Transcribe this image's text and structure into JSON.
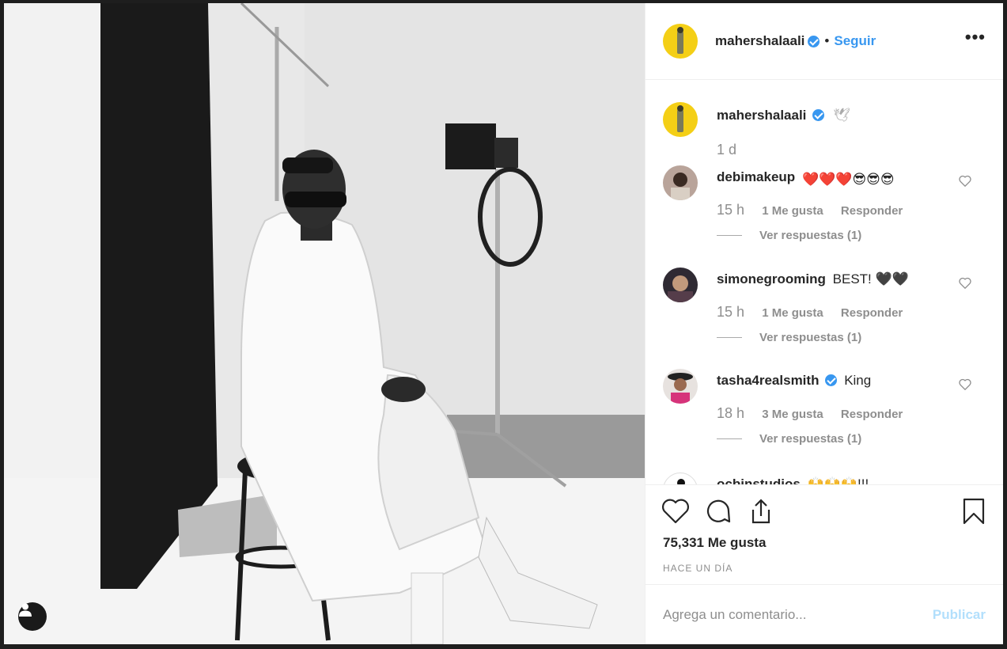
{
  "post": {
    "author": "mahershalaali",
    "separator": "•",
    "follow_label": "Seguir",
    "more_label": "•••"
  },
  "caption": {
    "user": "mahershalaali",
    "text": "🕊",
    "time": "1 d"
  },
  "comments": [
    {
      "user": "debimakeup",
      "text": "❤️❤️❤️😎😎😎",
      "time": "15 h",
      "likes": "1 Me gusta",
      "reply": "Responder",
      "view_replies": "Ver respuestas (1)"
    },
    {
      "user": "simonegrooming",
      "text": "BEST! 🖤🖤",
      "time": "15 h",
      "likes": "1 Me gusta",
      "reply": "Responder",
      "view_replies": "Ver respuestas (1)"
    },
    {
      "user": "tasha4realsmith",
      "verified": true,
      "text": "King",
      "time": "18 h",
      "likes": "3 Me gusta",
      "reply": "Responder",
      "view_replies": "Ver respuestas (1)"
    },
    {
      "user": "ocbinstudios",
      "text": "🙌🙌🙌!!!"
    }
  ],
  "stats": {
    "likes": "75,331 Me gusta",
    "time_ago": "HACE UN DÍA"
  },
  "composer": {
    "placeholder": "Agrega un comentario...",
    "publish_label": "Publicar"
  },
  "icons": {
    "like": "heart-icon",
    "comment": "comment-icon",
    "share": "share-icon",
    "save": "bookmark-icon",
    "tagged_people": "user-icon"
  },
  "colors": {
    "link": "#3897f0",
    "publish_disabled": "#b2dffc",
    "muted": "#8e8e8e",
    "avatar_bg": "#f4cf16"
  }
}
